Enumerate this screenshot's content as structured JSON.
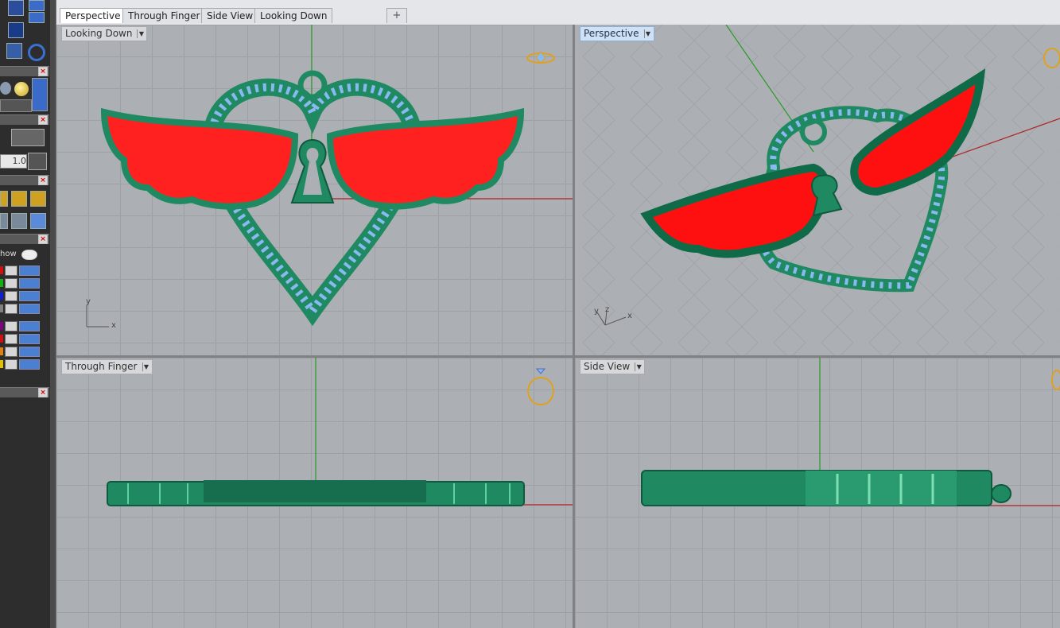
{
  "tabs": [
    "Perspective",
    "Through Finger",
    "Side View",
    "Looking Down"
  ],
  "active_tab": "Perspective",
  "add_tab_symbol": "+",
  "viewports": {
    "top_left": {
      "label": "Looking Down",
      "active": false
    },
    "top_right": {
      "label": "Perspective",
      "active": true
    },
    "bottom_left": {
      "label": "Through Finger",
      "active": false
    },
    "bottom_right": {
      "label": "Side View",
      "active": false
    }
  },
  "axes": {
    "top_left": {
      "x": "x",
      "y": "y"
    },
    "top_right": {
      "x": "x",
      "y": "y",
      "z": "z"
    }
  },
  "left_toolbar": {
    "snap_value": "1.0",
    "layer_panel_label": "how",
    "layer_colors": [
      "#d01010",
      "#10b010",
      "#1020d0",
      "#808080",
      "#800080",
      "#d01010",
      "#e08010",
      "#e0c000"
    ]
  },
  "colors": {
    "metal": "#1f8a62",
    "metal_dark": "#0f5a3e",
    "wing_enamel": "#ff2020",
    "gems": "#8ab8f0",
    "x_axis": "#b02020",
    "y_axis": "#20a020",
    "ring_widget": "#e0a020"
  }
}
